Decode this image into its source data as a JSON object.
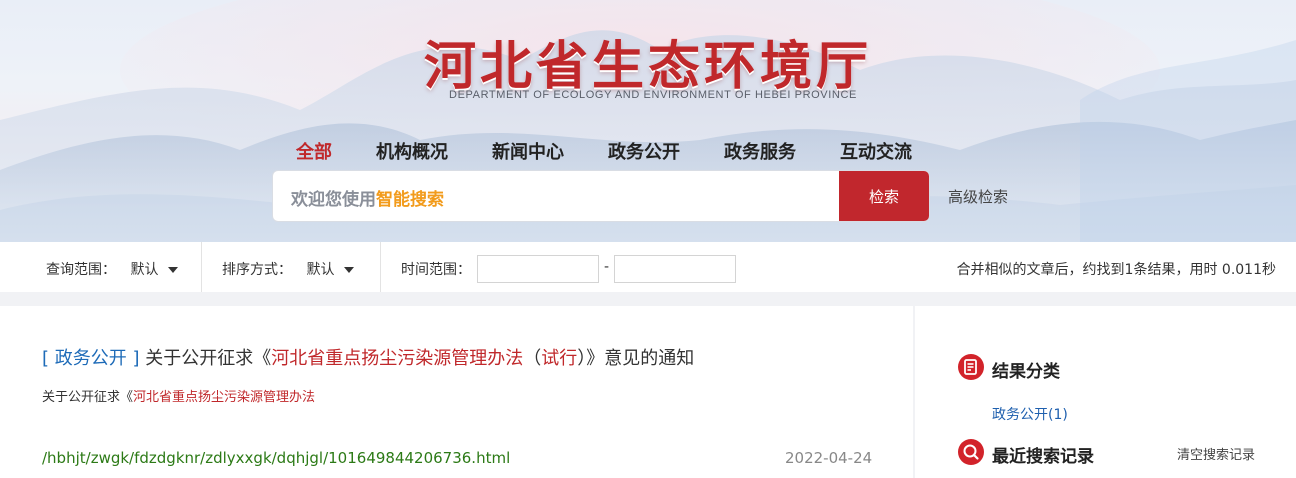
{
  "header": {
    "site_title": "河北省生态环境厅",
    "site_subtitle": "DEPARTMENT OF ECOLOGY AND ENVIRONMENT OF HEBEI PROVINCE",
    "nav": [
      {
        "label": "全部",
        "active": true
      },
      {
        "label": "机构概况"
      },
      {
        "label": "新闻中心"
      },
      {
        "label": "政务公开"
      },
      {
        "label": "政务服务"
      },
      {
        "label": "互动交流"
      }
    ],
    "search": {
      "placeholder_prefix": "欢迎您使用",
      "placeholder_highlight": "智能搜索",
      "button_label": "检索",
      "advanced_label": "高级检索"
    }
  },
  "filter_bar": {
    "scope_label": "查询范围：",
    "scope_value": "默认",
    "sort_label": "排序方式：",
    "sort_value": "默认",
    "time_label": "时间范围：",
    "time_from": "",
    "time_to": "",
    "time_separator": "-",
    "summary": "合并相似的文章后，约找到1条结果，用时 0.011秒"
  },
  "results": [
    {
      "category": "[ 政务公开 ]",
      "title_before": "关于公开征求《",
      "title_highlight": "河北省重点扬尘污染源管理办法",
      "title_paren_open": "（",
      "title_paren_word": "试行",
      "title_paren_close": "）",
      "title_after": "》意见的通知",
      "snippet_before": "关于公开征求《",
      "snippet_highlight": "河北省重点扬尘污染源管理办法",
      "url": "/hbhjt/zwgk/fdzdgknr/zdlyxxgk/dqhjgl/101649844206736.html",
      "date": "2022-04-24"
    }
  ],
  "sidebar": {
    "classification_title": "结果分类",
    "classification_items": [
      "政务公开(1)"
    ],
    "history_title": "最近搜索记录",
    "clear_history_label": "清空搜索记录"
  },
  "colors": {
    "brand_red": "#c1272d",
    "highlight_orange": "#f29b1b",
    "link_blue": "#1e6bb8",
    "url_green": "#2c7a16"
  }
}
